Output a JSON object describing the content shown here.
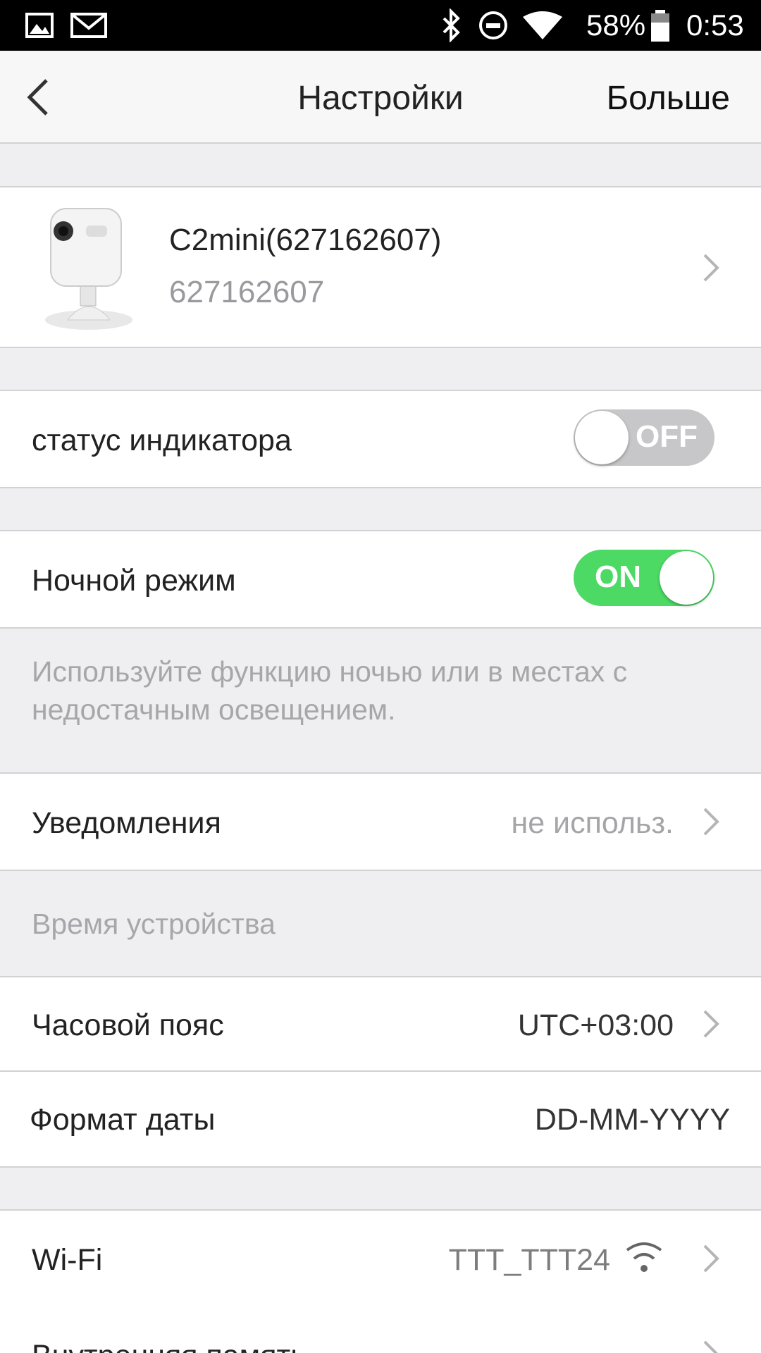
{
  "status_bar": {
    "battery": "58%",
    "time": "0:53"
  },
  "nav": {
    "title": "Настройки",
    "more": "Больше"
  },
  "device": {
    "name": "C2mini(627162607)",
    "serial": "627162607"
  },
  "indicator": {
    "label": "статус индикатора",
    "toggle_text": "OFF",
    "on": false
  },
  "night": {
    "label": "Ночной режим",
    "toggle_text": "ON",
    "on": true,
    "note": "Используйте функцию ночью или в местах с недостачным освещением."
  },
  "notifications": {
    "label": "Уведомления",
    "value": "не использ."
  },
  "device_time": {
    "section_label": "Время устройства",
    "timezone_label": "Часовой пояс",
    "timezone_value": "UTC+03:00",
    "date_format_label": "Формат даты",
    "date_format_value": "DD-MM-YYYY"
  },
  "wifi": {
    "label": "Wi-Fi",
    "value": "TTT_TTT24"
  },
  "storage": {
    "label": "Внутренняя память"
  },
  "colors": {
    "toggle_on": "#4cd964",
    "toggle_off": "#c7c7c9"
  }
}
